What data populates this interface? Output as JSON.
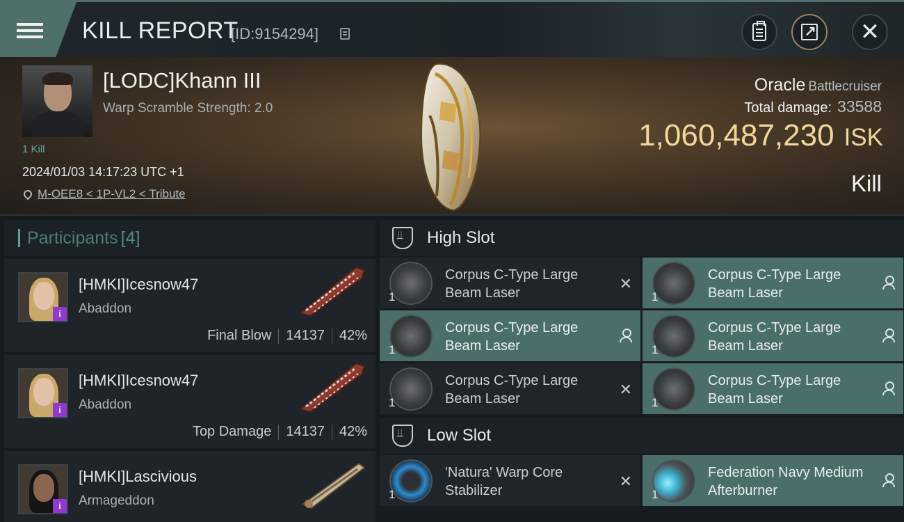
{
  "header": {
    "title": "KILL REPORT",
    "id_label": "[ID:9154294]"
  },
  "victim": {
    "name": "[LODC]Khann III",
    "subtitle": "Warp Scramble Strength: 2.0",
    "kill_count": "1 Kill",
    "timestamp": "2024/01/03 14:17:23 UTC +1",
    "location": "M-OEE8 < 1P-VL2 < Tribute",
    "ship": "Oracle",
    "ship_class": "Battlecruiser",
    "total_damage_label": "Total damage:",
    "total_damage": "33588",
    "isk_value": "1,060,487,230",
    "isk_unit": "ISK",
    "result": "Kill"
  },
  "participants": {
    "label": "Participants",
    "count": "[4]",
    "rows": [
      {
        "name": "[HMKI]Icesnow47",
        "ship": "Abaddon",
        "tag": "Final Blow",
        "damage": "14137",
        "percent": "42%"
      },
      {
        "name": "[HMKI]Icesnow47",
        "ship": "Abaddon",
        "tag": "Top Damage",
        "damage": "14137",
        "percent": "42%"
      },
      {
        "name": "[HMKI]Lascivious",
        "ship": "Armageddon",
        "tag": "",
        "damage": "",
        "percent": ""
      }
    ]
  },
  "slots": {
    "high_label": "High Slot",
    "low_label": "Low Slot",
    "high": [
      {
        "name": "Corpus C-Type Large Beam Laser",
        "qty": "1",
        "state": "destroyed"
      },
      {
        "name": "Corpus C-Type Large Beam Laser",
        "qty": "1",
        "state": "dropped"
      },
      {
        "name": "Corpus C-Type Large Beam Laser",
        "qty": "1",
        "state": "dropped"
      },
      {
        "name": "Corpus C-Type Large Beam Laser",
        "qty": "1",
        "state": "dropped"
      },
      {
        "name": "Corpus C-Type Large Beam Laser",
        "qty": "1",
        "state": "destroyed"
      },
      {
        "name": "Corpus C-Type Large Beam Laser",
        "qty": "1",
        "state": "dropped"
      }
    ],
    "low": [
      {
        "name": "'Natura' Warp Core Stabilizer",
        "qty": "1",
        "state": "destroyed"
      },
      {
        "name": "Federation Navy Medium Afterburner",
        "qty": "1",
        "state": "dropped"
      }
    ]
  },
  "icons": {
    "menu": "hamburger-menu-icon",
    "copy": "copy-icon",
    "clipboard": "clipboard-icon",
    "share": "share-icon",
    "close": "close-icon",
    "location": "map-pin-icon",
    "destroyed": "x-icon",
    "dropped": "person-icon"
  },
  "colors": {
    "accent_teal": "#4e6f6a",
    "isk_gold": "#f3d79a",
    "badge_purple": "#8f39cf"
  }
}
